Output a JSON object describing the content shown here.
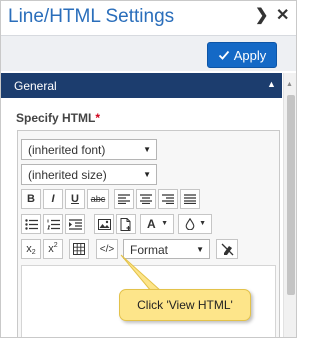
{
  "panel": {
    "title": "Line/HTML Settings",
    "expand_icon": "chevron-right-icon",
    "close_icon": "close-icon"
  },
  "actions": {
    "apply_label": "Apply",
    "apply_color": "#1469c6"
  },
  "section": {
    "label": "General",
    "header_color": "#1c3d6e"
  },
  "field": {
    "label": "Specify HTML",
    "required_mark": "*"
  },
  "editor": {
    "font_select": "(inherited font)",
    "size_select": "(inherited size)",
    "bold": "B",
    "italic": "I",
    "underline": "U",
    "strike": "abc",
    "font_color": "A",
    "subscript": "x",
    "subscript_mark": "2",
    "superscript": "x",
    "superscript_mark": "2",
    "view_html": "</>",
    "format_select": "Format",
    "body_text": ""
  },
  "callout": {
    "text": "Click 'View HTML'",
    "color": "#fde58a"
  }
}
